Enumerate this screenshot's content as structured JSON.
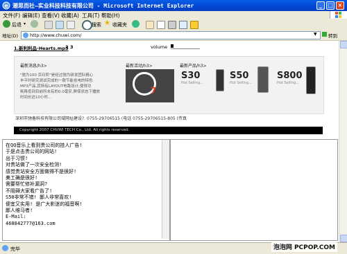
{
  "window": {
    "title": "潮思而社—实业科技科技有限公司 - Microsoft Internet Explorer",
    "minimize_glyph": "_",
    "maximize_glyph": "□",
    "close_glyph": "×"
  },
  "menu": {
    "items": [
      "文件(F)",
      "编辑(E)",
      "查看(V)",
      "收藏(A)",
      "工具(T)",
      "帮助(H)"
    ]
  },
  "toolbar": {
    "back_label": "后退",
    "search_label": "搜索",
    "favorites_label": "收藏夹"
  },
  "address": {
    "label": "地址(D)",
    "url": "http://www.chuwi.com/",
    "go_label": "转到",
    "links_label": "链接"
  },
  "player": {
    "track": "1.新利利品-Hearts.mp3",
    "page2": "2",
    "page3": "3",
    "volume_label": "volume"
  },
  "promo": {
    "col1_head": "最新消息/h3>",
    "col1_body": [
      "\"驰为100 百日阶\"是经过驰为研发团队精心",
      "丰平时研究测试完成的一款节能省电的特色",
      "MP3产品,其特有LAYOUT电路设计,使得功",
      "耗降低到目前所未有的0.0毫安,屏保状态下播放",
      "时间长达10小时..."
    ],
    "col2_head": "最新活动/h3>",
    "col3_head": "最新产品/h3>",
    "products": [
      {
        "name": "S30",
        "sub": "Hot Selling..."
      },
      {
        "name": "S50",
        "sub": "Hot Selling..."
      },
      {
        "name": "S800",
        "sub": "Hot Selling..."
      }
    ]
  },
  "footer": {
    "links": "深圳市驰备科技有限公司域网址建设?.  0755-29706515 (电话  0755-29706515-805 (传真",
    "copyright": "Copyright 2007 CHUWI TECH Co., Ltd. All rights reserved."
  },
  "text_frame": {
    "lines": [
      "在QQ音乐上看到贵公司的挂人广告!",
      "于是点击贵公司的网站!",
      "出于习惯!",
      "对贵站做了一次安全检测!",
      "感觉贵站安全方面做得不是很好!",
      "美工确是很好!",
      "需要帮忙修补漏洞?",
      "不阻碍大家看广告了!",
      "S50非常不错! 鄙人非常喜欢!",
      "便宜又实用! 是广大影迷的福音啊!",
      "鄙人维马者!",
      "E-Mail:",
      "468842777@163.com"
    ]
  },
  "status": {
    "text": "完毕"
  },
  "watermark": {
    "text": "泡泡网 PCPOP.COM"
  }
}
